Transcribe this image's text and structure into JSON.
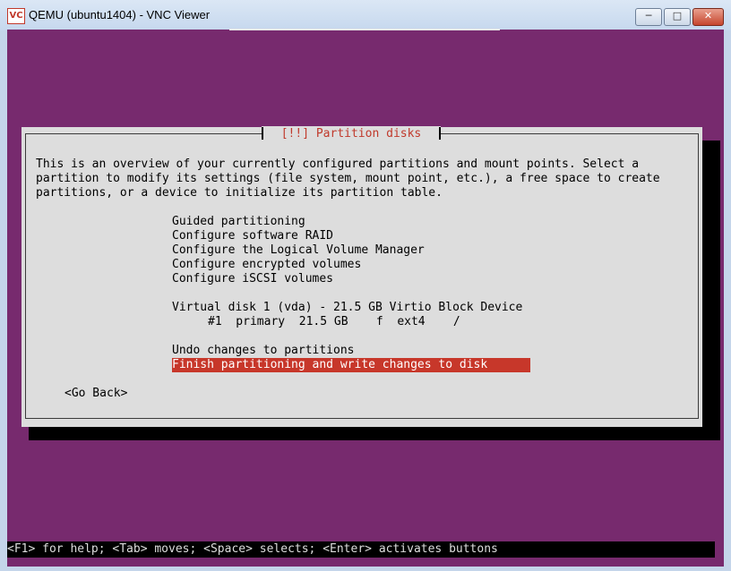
{
  "window": {
    "title": "QEMU (ubuntu1404) - VNC Viewer",
    "app_icon_text": "VC",
    "controls": {
      "minimize": "─",
      "maximize": "□",
      "close": "✕"
    }
  },
  "dialog": {
    "title": "[!!] Partition disks",
    "intro": [
      "This is an overview of your currently configured partitions and mount points. Select a",
      "partition to modify its settings (file system, mount point, etc.), a free space to create",
      "partitions, or a device to initialize its partition table."
    ],
    "options": [
      "Guided partitioning",
      "Configure software RAID",
      "Configure the Logical Volume Manager",
      "Configure encrypted volumes",
      "Configure iSCSI volumes"
    ],
    "disk": "Virtual disk 1 (vda) - 21.5 GB Virtio Block Device",
    "partition": "#1  primary  21.5 GB    f  ext4    /",
    "undo": "Undo changes to partitions",
    "finish": "Finish partitioning and write changes to disk",
    "go_back": "<Go Back>"
  },
  "status_bar": "<F1> for help; <Tab> moves; <Space> selects; <Enter> activates buttons"
}
